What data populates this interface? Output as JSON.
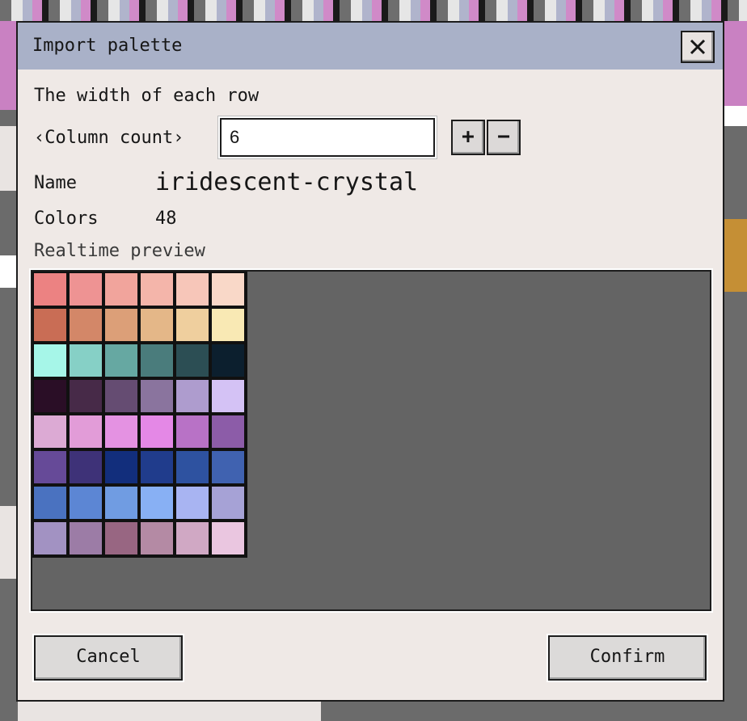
{
  "dialog": {
    "title": "Import palette",
    "close_icon": "close-icon"
  },
  "description": "The width of each row",
  "column_count": {
    "label": "‹Column count›",
    "value": "6",
    "plus_label": "+",
    "minus_label": "−"
  },
  "info": {
    "name_label": "Name",
    "name_value": "iridescent-crystal",
    "colors_label": "Colors",
    "colors_value": "48"
  },
  "preview": {
    "label": "Realtime preview",
    "columns": 6,
    "swatches": [
      "#ec8282",
      "#ee9393",
      "#f1a49c",
      "#f4b5aa",
      "#f7c6b9",
      "#f9d8c8",
      "#c96d55",
      "#d38768",
      "#dc9f78",
      "#e4b788",
      "#efcf9e",
      "#f9e9b4",
      "#a6f6e8",
      "#86d0c6",
      "#66a8a2",
      "#4a7c7c",
      "#2c4e54",
      "#0c1f2e",
      "#2a0e26",
      "#472a48",
      "#654c72",
      "#8a749e",
      "#ae9cce",
      "#d4c2f5",
      "#dcaad4",
      "#e29cd8",
      "#e492e2",
      "#e488e6",
      "#b872c6",
      "#8c5ca8",
      "#664a98",
      "#3e3278",
      "#122e7c",
      "#203c8c",
      "#2e52a0",
      "#4062b0",
      "#4a72c0",
      "#5c86d4",
      "#709ce2",
      "#88b0f4",
      "#a8b4f2",
      "#a6a2d6",
      "#a292c2",
      "#9c7ca6",
      "#986682",
      "#b48aa4",
      "#d0a8c4",
      "#eac6e0"
    ]
  },
  "buttons": {
    "cancel": "Cancel",
    "confirm": "Confirm"
  }
}
